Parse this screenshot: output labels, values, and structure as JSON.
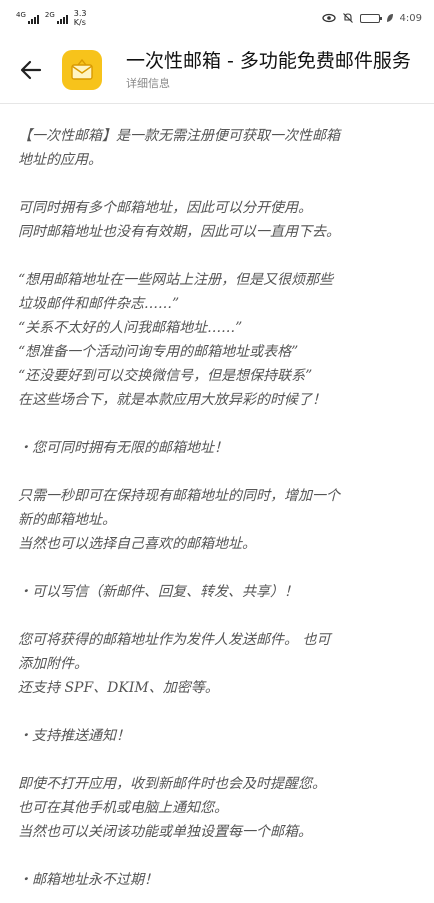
{
  "status_bar": {
    "signal1": "4G",
    "signal2": "2G",
    "speed_value": "3.3",
    "speed_unit": "K/s",
    "battery": "",
    "time": "4:09"
  },
  "header": {
    "title": "一次性邮箱 - 多功能免费邮件服务",
    "subtitle": "详细信息"
  },
  "description": [
    [
      "【一次性邮箱】是一款无需注册便可获取一次性邮箱",
      "地址的应用。"
    ],
    [
      "可同时拥有多个邮箱地址，因此可以分开使用。",
      "同时邮箱地址也没有有效期，因此可以一直用下去。"
    ],
    [
      "“想用邮箱地址在一些网站上注册，但是又很烦那些",
      "垃圾邮件和邮件杂志……”",
      "“关系不太好的人问我邮箱地址……”",
      "“想准备一个活动问询专用的邮箱地址或表格”",
      "“还没要好到可以交换微信号，但是想保持联系”",
      "在这些场合下，就是本款应用大放异彩的时候了！"
    ],
    [
      "・您可同时拥有无限的邮箱地址！"
    ],
    [
      "只需一秒即可在保持现有邮箱地址的同时，增加一个",
      "新的邮箱地址。",
      "当然也可以选择自己喜欢的邮箱地址。"
    ],
    [
      "・可以写信（新邮件、回复、转发、共享）！"
    ],
    [
      "您可将获得的邮箱地址作为发件人发送邮件。 也可",
      "添加附件。",
      "还支持 SPF、DKIM、加密等。"
    ],
    [
      "・支持推送通知！"
    ],
    [
      "即使不打开应用，收到新邮件时也会及时提醒您。",
      "也可在其他手机或电脑上通知您。",
      "当然也可以关闭该功能或单独设置每一个邮箱。"
    ],
    [
      "・邮箱地址永不过期！"
    ]
  ]
}
